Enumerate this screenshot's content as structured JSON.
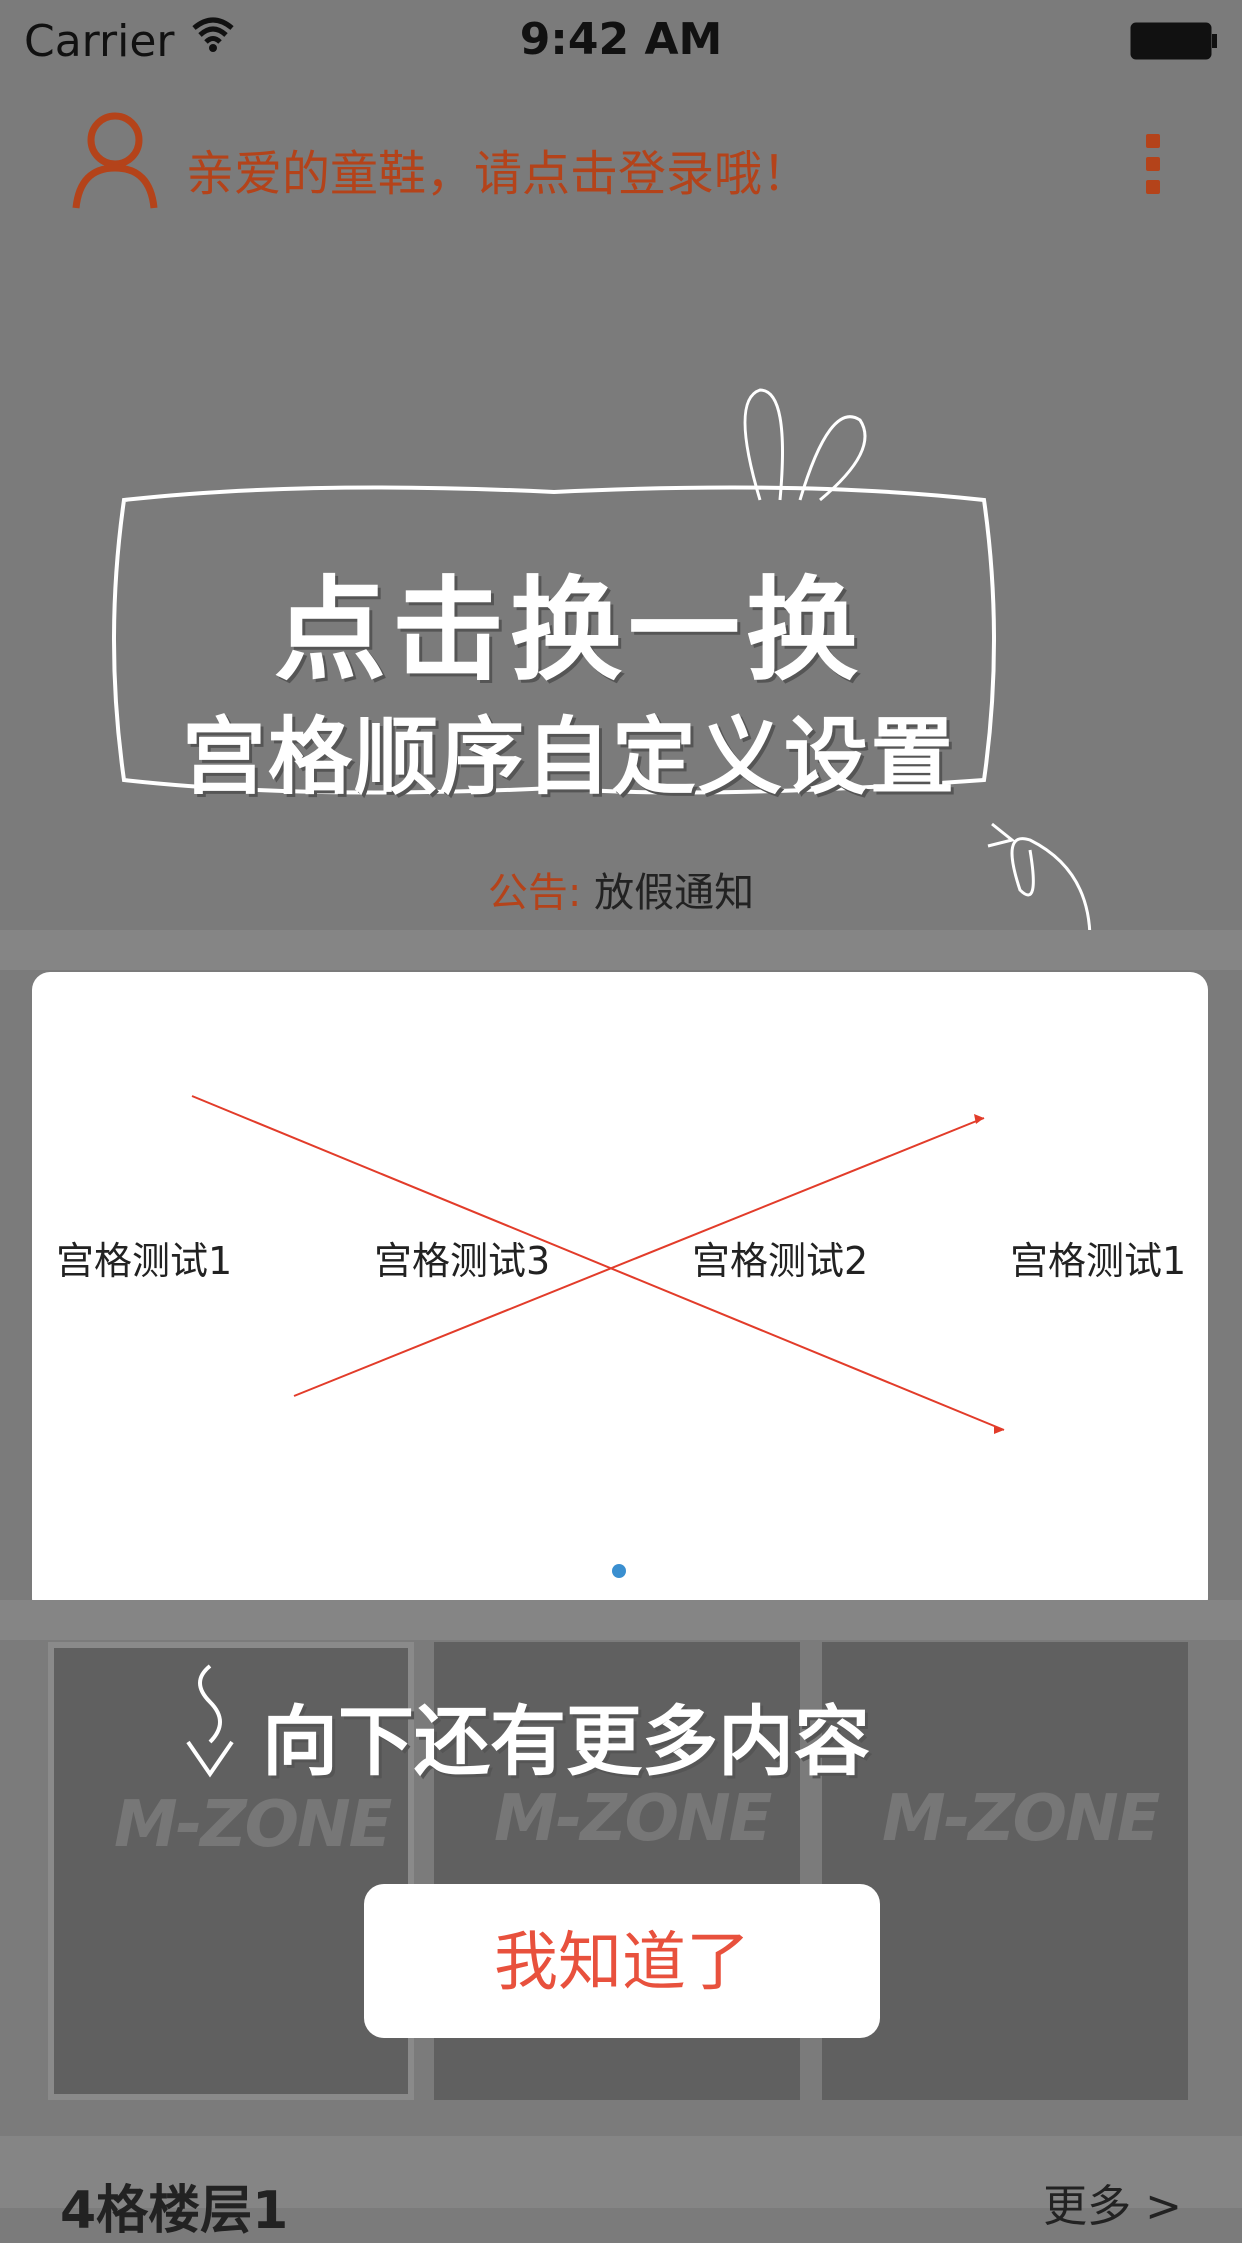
{
  "status_bar": {
    "carrier": "Carrier",
    "time": "9:42 AM"
  },
  "header": {
    "login_prompt": "亲爱的童鞋，请点击登录哦！"
  },
  "guide_banner": {
    "title": "点击换一换",
    "subtitle": "宫格顺序自定义设置"
  },
  "notice": {
    "label": "公告:",
    "text": "放假通知"
  },
  "grid": {
    "items": [
      "宫格测试1",
      "宫格测试3",
      "宫格测试2",
      "宫格测试1"
    ]
  },
  "thumbnails": [
    {
      "logo": "M-ZONE"
    },
    {
      "logo": "M-ZONE"
    },
    {
      "logo": "M-ZONE"
    }
  ],
  "scroll_hint": "向下还有更多内容",
  "dialog": {
    "confirm_label": "我知道了"
  },
  "floor": {
    "title": "4格楼层1",
    "more": "更多 >"
  },
  "colors": {
    "accent": "#b4431a",
    "button_text": "#e8513d",
    "page_indicator": "#3a8fd0"
  }
}
